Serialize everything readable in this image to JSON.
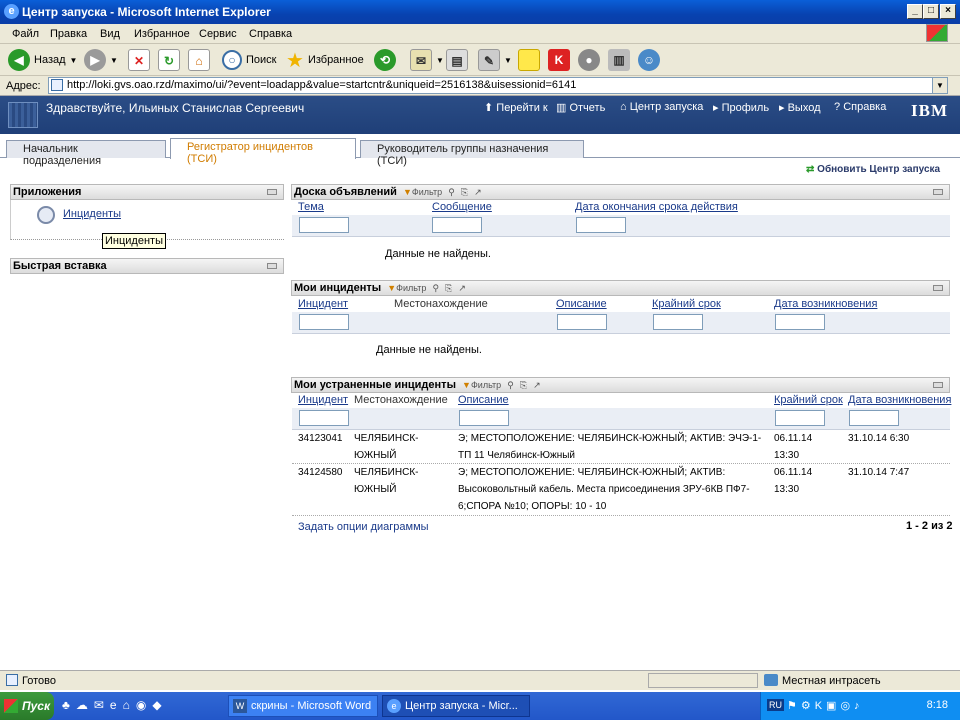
{
  "window": {
    "title": "Центр запуска - Microsoft Internet Explorer"
  },
  "menu": [
    "Файл",
    "Правка",
    "Вид",
    "Избранное",
    "Сервис",
    "Справка"
  ],
  "toolbar": {
    "back": "Назад",
    "search": "Поиск",
    "favorites": "Избранное"
  },
  "address": {
    "label": "Адрес:",
    "url": "http://loki.gvs.oao.rzd/maximo/ui/?event=loadapp&value=startcntr&uniqueid=2516138&uisessionid=6141"
  },
  "header": {
    "greeting": "Здравствуйте, Ильиных Станислав Сергеевич",
    "links": [
      "Перейти к",
      "Отчеть",
      "Центр запуска",
      "Профиль",
      "Выход",
      "Справка"
    ],
    "logo": "IBM"
  },
  "tabs": [
    "Начальник подразделения",
    "Регистратор инцидентов (ТСИ)",
    "Руководитель группы назначения (ТСИ)"
  ],
  "refresh": "Обновить Центр запуска",
  "apps": {
    "title": "Приложения",
    "link": "Инциденты",
    "tooltip": "Инциденты"
  },
  "quick": {
    "title": "Быстрая вставка"
  },
  "board": {
    "title": "Доска объявлений",
    "filter": "Фильтр",
    "columns": [
      "Тема",
      "Сообщение",
      "Дата окончания срока действия"
    ],
    "empty": "Данные не найдены."
  },
  "mine": {
    "title": "Мои инциденты",
    "filter": "Фильтр",
    "columns": [
      "Инцидент",
      "Местонахождение",
      "Описание",
      "Крайний срок",
      "Дата возникновения"
    ],
    "empty": "Данные не найдены."
  },
  "resolved": {
    "title": "Мои устраненные инциденты",
    "filter": "Фильтр",
    "columns": [
      "Инцидент",
      "Местонахождение",
      "Описание",
      "Крайний срок",
      "Дата возникновения"
    ],
    "rows": [
      {
        "id": "34123041",
        "loc1": "ЧЕЛЯБИНСК-",
        "loc2": "ЮЖНЫЙ",
        "d1": "Э; МЕСТОПОЛОЖЕНИЕ: ЧЕЛЯБИНСК-ЮЖНЫЙ; АКТИВ: ЭЧЭ-1-",
        "d2": "ТП 11 Челябинск-Южный",
        "due1": "06.11.14",
        "due2": "13:30",
        "occ": "31.10.14 6:30"
      },
      {
        "id": "34124580",
        "loc1": "ЧЕЛЯБИНСК-",
        "loc2": "ЮЖНЫЙ",
        "d1": "Э; МЕСТОПОЛОЖЕНИЕ: ЧЕЛЯБИНСК-ЮЖНЫЙ; АКТИВ:",
        "d2": "Высоковольтный кабель. Места присоединения ЗРУ-6КВ ПФ7-",
        "d3": "6;СПОРА №10; ОПОРЫ: 10 - 10",
        "due1": "06.11.14",
        "due2": "13:30",
        "occ": "31.10.14 7:47"
      }
    ],
    "chart_opts": "Задать опции диаграммы",
    "paging": "1 - 2 из 2"
  },
  "status": {
    "ready": "Готово",
    "zone": "Местная интрасеть"
  },
  "taskbar": {
    "start": "Пуск",
    "tasks": [
      "скрины - Microsoft Word",
      "Центр запуска - Micr..."
    ],
    "lang": "RU",
    "clock": "8:18"
  }
}
